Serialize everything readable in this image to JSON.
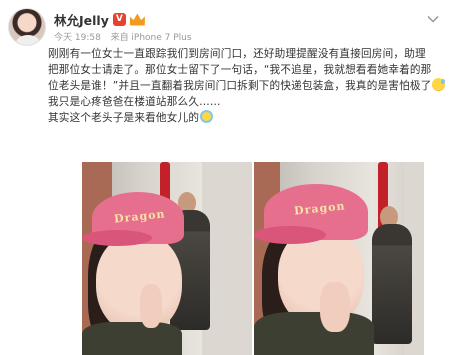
{
  "post": {
    "username": "林允Jelly",
    "verified_badge": "V",
    "timestamp": "今天 19:58",
    "source": "来自 iPhone 7 Plus",
    "text_lines": [
      "刚刚有一位女士一直跟踪我们到房间门口，还好助理提醒没有直接回房间，助理",
      "把那位女士请走了。那位女士留下了一句话，“我不追星，我就想看看她幸着的那",
      "位老头是谁！”并且一直翻着我房间门口拆剩下的快递包装盒，我真的是害怕极了",
      "我只是心疼爸爸在楼道站那么久……",
      "其实这个老头子是来看他女儿的"
    ]
  },
  "photos": {
    "cap_text": "Dragon"
  },
  "colors": {
    "badge": "#e8412d",
    "crown": "#f39b1f",
    "meta_text": "#999999",
    "cap": "#e76f8e",
    "pole": "#c2212a"
  }
}
